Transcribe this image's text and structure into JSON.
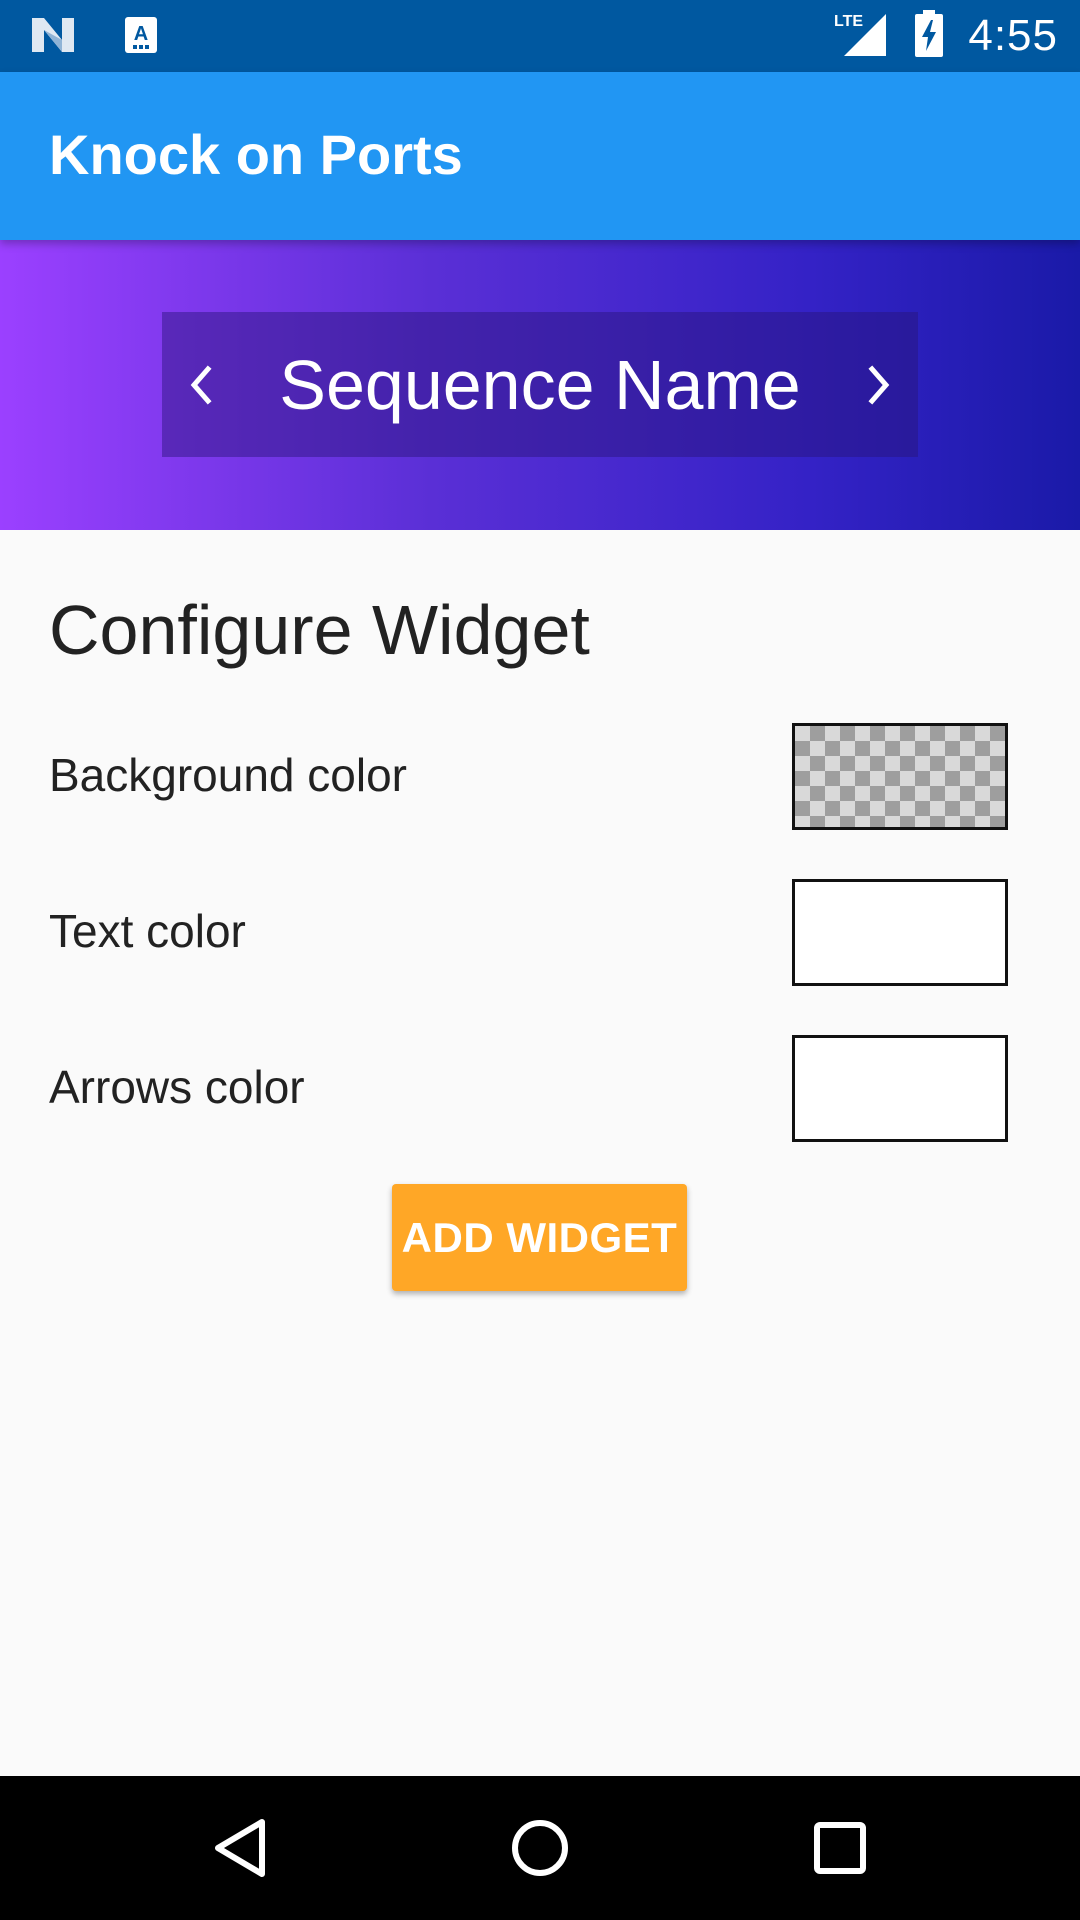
{
  "status_bar": {
    "time": "4:55",
    "network": "LTE",
    "icons": [
      "n-logo-icon",
      "accessibility-notification-icon",
      "lte-signal-icon",
      "battery-charging-icon"
    ]
  },
  "app_bar": {
    "title": "Knock on Ports",
    "color": "#2196f3"
  },
  "preview": {
    "sequence_name": "Sequence Name",
    "left_arrow_icon": "chevron-left-icon",
    "right_arrow_icon": "chevron-right-icon"
  },
  "config": {
    "title": "Configure Widget",
    "rows": [
      {
        "label": "Background color",
        "swatch": "transparent"
      },
      {
        "label": "Text color",
        "swatch": "#ffffff"
      },
      {
        "label": "Arrows color",
        "swatch": "#ffffff"
      }
    ],
    "add_button_label": "ADD WIDGET",
    "button_color": "#ffa726"
  },
  "nav_bar": {
    "icons": [
      "back-icon",
      "home-icon",
      "recents-icon"
    ]
  }
}
